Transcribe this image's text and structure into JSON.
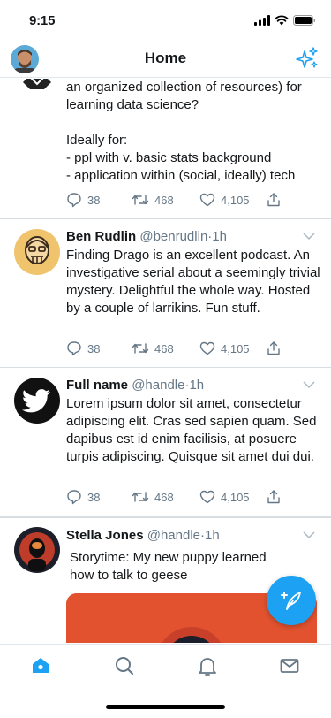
{
  "status_bar": {
    "time": "9:15"
  },
  "header": {
    "title": "Home"
  },
  "tweets": [
    {
      "text": "an organized collection of resources) for learning data science?\n\nIdeally for:\n- ppl with v. basic stats background\n- application within (social, ideally) tech",
      "replies": "38",
      "retweets": "468",
      "likes": "4,105"
    },
    {
      "name": "Ben Rudlin",
      "handle": "@benrudlin",
      "separator": "·",
      "time": "1h",
      "text": "Finding Drago is an excellent podcast. An investigative serial about a seemingly trivial mystery. Delightful the whole way. Hosted by a couple of larrikins. Fun stuff.",
      "replies": "38",
      "retweets": "468",
      "likes": "4,105"
    },
    {
      "name": "Full name",
      "handle": "@handle",
      "separator": "·",
      "time": "1h",
      "text": "Lorem ipsum dolor sit amet, consectetur adipiscing elit. Cras sed sapien quam. Sed dapibus est id enim facilisis, at posuere turpis adipiscing. Quisque sit amet dui dui.",
      "replies": "38",
      "retweets": "468",
      "likes": "4,105"
    },
    {
      "name": "Stella Jones",
      "handle": "@handle",
      "separator": "·",
      "time": "1h",
      "text": "Storytime: My new puppy learned how to talk to geese"
    }
  ],
  "tab_bar": {
    "items": [
      "home-icon",
      "search-icon",
      "notifications-icon",
      "messages-icon"
    ],
    "active": "home-icon"
  },
  "colors": {
    "accent": "#1da1f2",
    "text": "#14171a",
    "muted": "#657786",
    "divider": "#d8dde1"
  }
}
